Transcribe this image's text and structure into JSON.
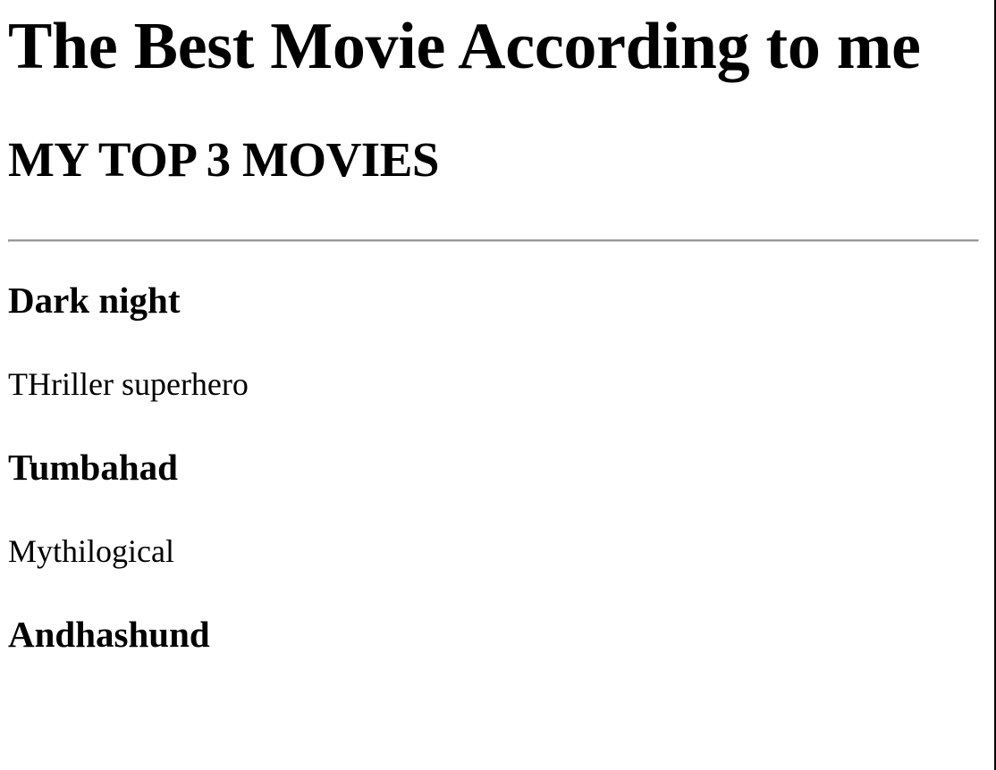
{
  "page": {
    "title": "The Best Movie According to me",
    "section_title": "MY TOP 3 MOVIES"
  },
  "movies": [
    {
      "name": "Dark night",
      "genre": "THriller superhero"
    },
    {
      "name": "Tumbahad",
      "genre": "Mythilogical"
    },
    {
      "name": "Andhashund"
    }
  ]
}
